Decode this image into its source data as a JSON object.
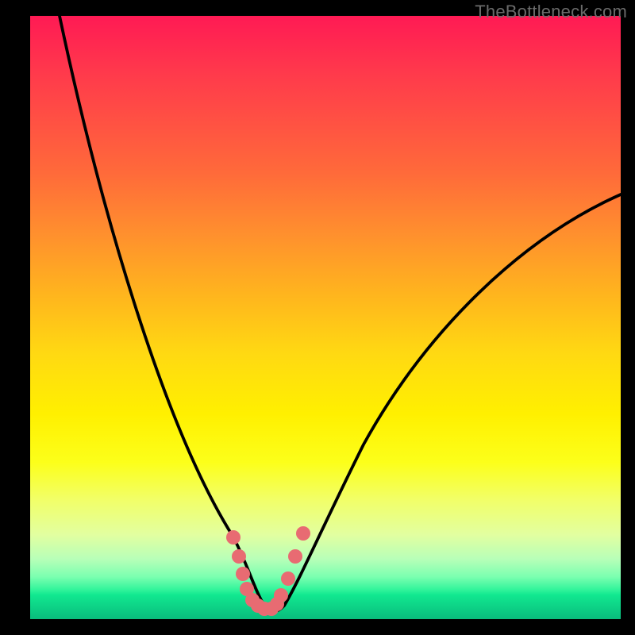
{
  "watermark": "TheBottleneck.com",
  "colors": {
    "background": "#000000",
    "curve_stroke": "#000000",
    "marker_fill": "#e86b72",
    "gradient_top": "#ff1a54",
    "gradient_bottom": "#0abc7c"
  },
  "chart_data": {
    "type": "line",
    "title": "",
    "xlabel": "",
    "ylabel": "",
    "xlim": [
      0,
      100
    ],
    "ylim": [
      0,
      100
    ],
    "grid": false,
    "legend": false,
    "annotations": [
      "TheBottleneck.com"
    ],
    "series": [
      {
        "name": "bottleneck-curve",
        "x": [
          5,
          8,
          11,
          14,
          17,
          20,
          23,
          26,
          29,
          32,
          34,
          36,
          37.5,
          39,
          40.5,
          42,
          44,
          46,
          49,
          53,
          58,
          64,
          71,
          79,
          88,
          98
        ],
        "y": [
          100,
          92,
          84,
          76,
          68,
          59,
          50,
          41,
          32,
          22,
          14,
          7,
          3,
          0.5,
          0.5,
          3,
          8,
          14,
          22,
          31,
          40,
          48,
          55,
          61,
          66,
          70
        ]
      }
    ],
    "markers": {
      "name": "highlight-points",
      "x": [
        34.5,
        35.4,
        36.1,
        36.8,
        37.7,
        38.6,
        39.5,
        40.7,
        41.6,
        42.2,
        43.3,
        44.6,
        45.9
      ],
      "y": [
        12.5,
        9.2,
        6.3,
        3.8,
        2.1,
        1.3,
        1.0,
        1.2,
        2.1,
        3.4,
        6.2,
        10.1,
        13.9
      ]
    }
  }
}
